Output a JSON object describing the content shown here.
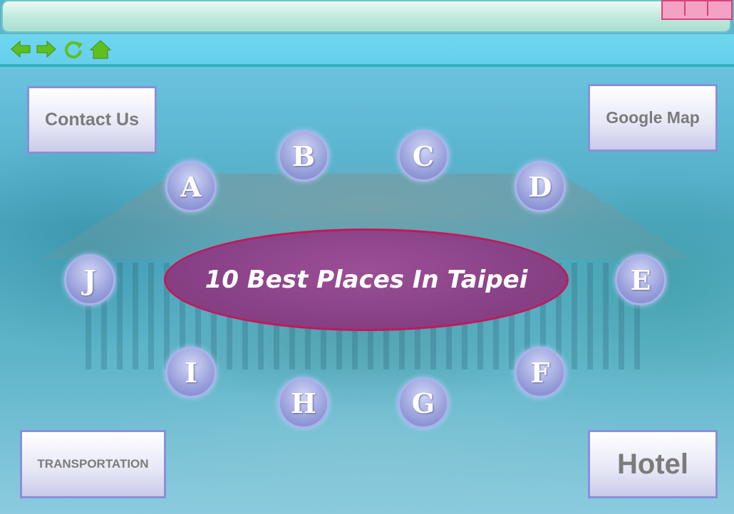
{
  "toolbar": {
    "icons": [
      "back-arrow-icon",
      "forward-arrow-icon",
      "refresh-icon",
      "home-icon"
    ],
    "icon_color": "#5fbf1f"
  },
  "buttons": {
    "contact": "Contact Us",
    "google_map": "Google Map",
    "transportation": "TRANSPORTATION",
    "hotel": "Hotel"
  },
  "places": {
    "a": "A",
    "b": "B",
    "c": "C",
    "d": "D",
    "e": "E",
    "f": "F",
    "g": "G",
    "h": "H",
    "i": "I",
    "j": "J"
  },
  "title": "10 Best Places In Taipei",
  "colors": {
    "accent_border": "#c2185b",
    "center_fill": "#863f82",
    "window_button": "#f3a2c4"
  }
}
